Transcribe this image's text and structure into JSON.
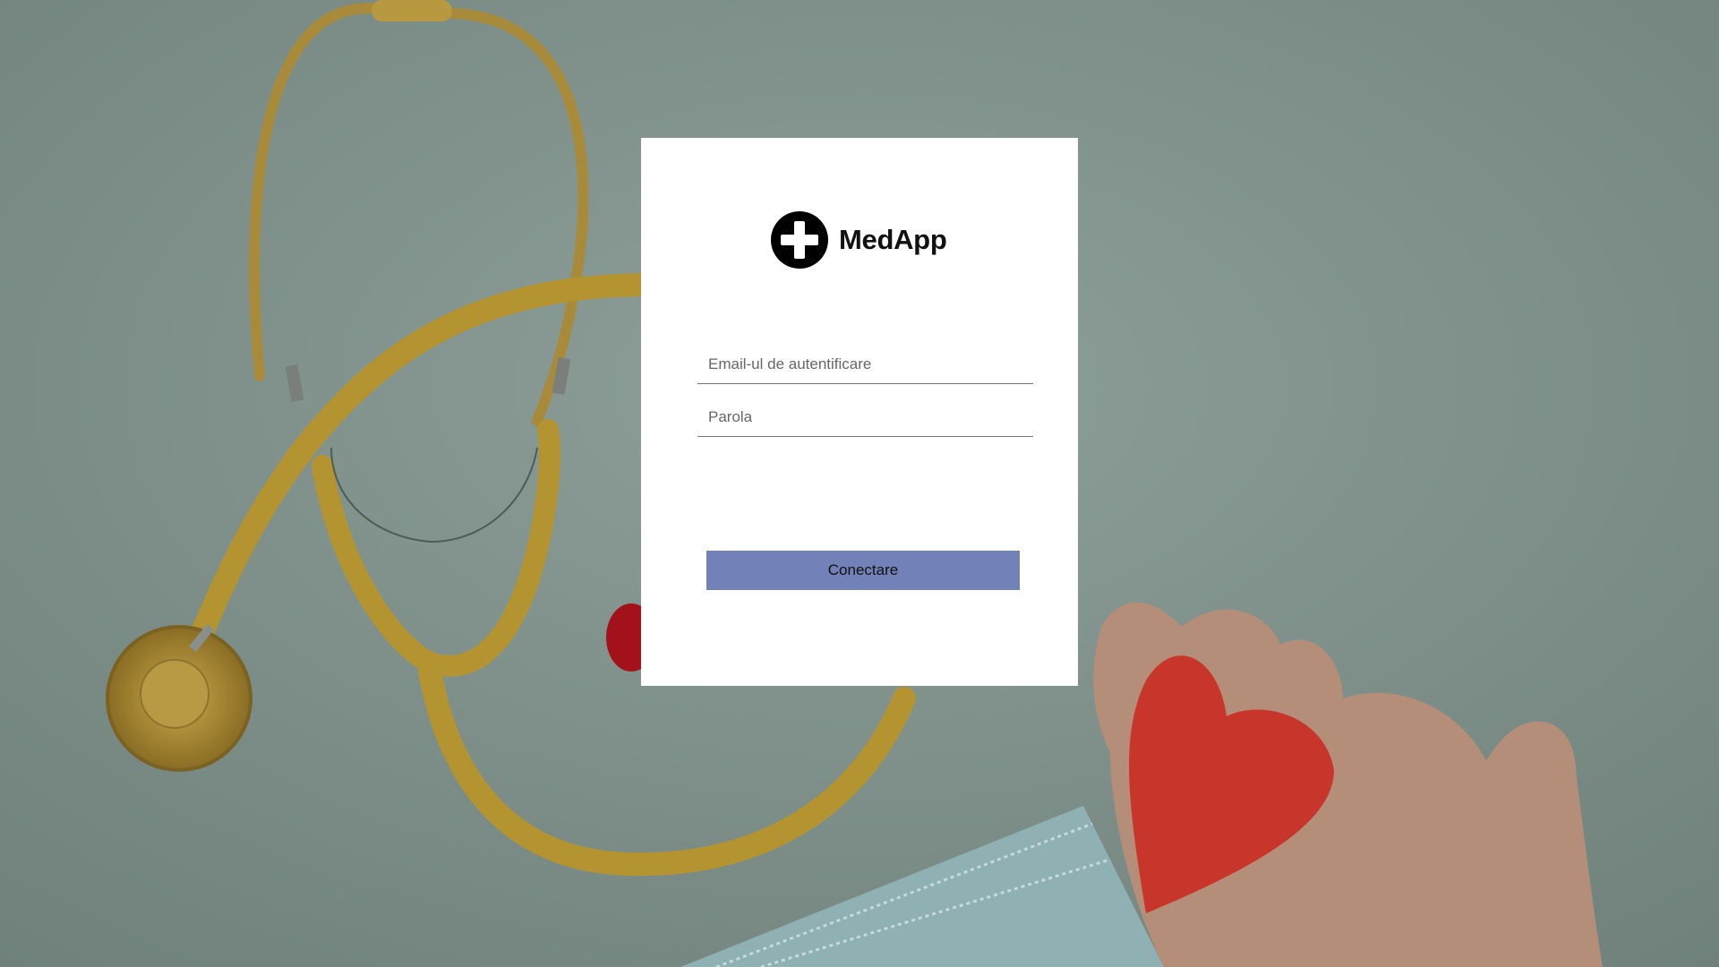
{
  "app": {
    "name": "MedApp",
    "logo_icon": "medical-cross-icon"
  },
  "login": {
    "email_placeholder": "Email-ul de autentificare",
    "password_placeholder": "Parola",
    "submit_label": "Conectare"
  },
  "colors": {
    "button_bg": "#7282b8",
    "card_bg": "#ffffff",
    "background_tint": "#7f8f8a"
  }
}
